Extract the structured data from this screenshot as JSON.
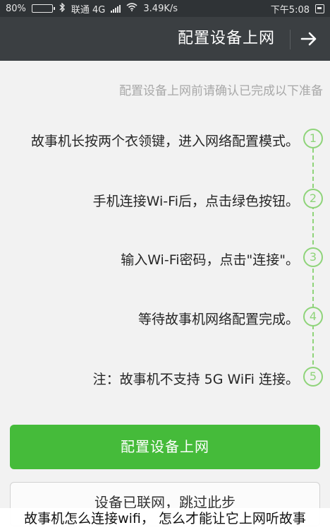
{
  "status_bar": {
    "battery_percent": "80%",
    "battery_level": 0.8,
    "network_speed": "3.49K/s",
    "carrier": "联通 4G",
    "time": "下午5:08",
    "icons": [
      "battery-icon",
      "bluetooth-icon",
      "wifi-icon",
      "signal-icon",
      "notification-icon"
    ]
  },
  "app_bar": {
    "title": "配置设备上网",
    "back_icon": "arrow-icon"
  },
  "intro": "配置设备上网前请确认已完成以下准备",
  "steps": [
    {
      "num": "1",
      "text": "故事机长按两个衣领键，进入网络配置模式。"
    },
    {
      "num": "2",
      "text": "手机连接Wi-Fi后，点击绿色按钮。"
    },
    {
      "num": "3",
      "text": "输入Wi-Fi密码，点击\"连接\"。"
    },
    {
      "num": "4",
      "text": "等待故事机网络配置完成。"
    },
    {
      "num": "5",
      "text": "注：故事机不支持 5G WiFi 连接。"
    }
  ],
  "buttons": {
    "primary": "配置设备上网",
    "secondary": "设备已联网，跳过此步"
  },
  "caption": "故事机怎么连接wifi， 怎么才能让它上网听故事",
  "colors": {
    "accent_green": "#45bb3a",
    "step_green": "#8fd47a",
    "app_bar": "#3b3f42",
    "status_bar": "#2f3336",
    "background": "#f2f2f2"
  }
}
